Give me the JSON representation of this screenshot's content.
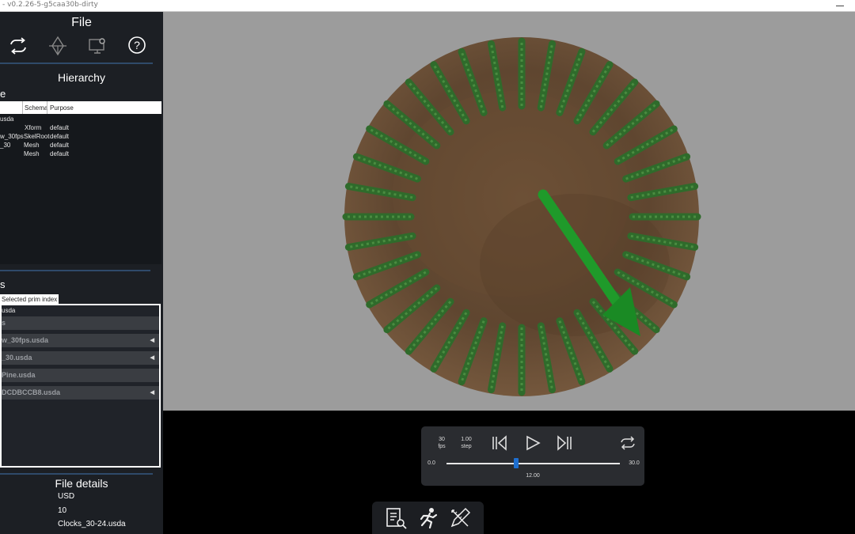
{
  "window": {
    "title": "- v0.2.26-5-g5caa30b-dirty"
  },
  "sidebar": {
    "file_title": "File",
    "toolbar": [
      {
        "name": "refresh-icon"
      },
      {
        "name": "pen-tool-icon"
      },
      {
        "name": "monitor-settings-icon"
      },
      {
        "name": "help-icon"
      }
    ],
    "hierarchy": {
      "title": "Hierarchy",
      "section_label": "e",
      "columns": {
        "schema": "Schema",
        "purpose": "Purpose"
      },
      "rows": [
        {
          "name": "usda",
          "schema": "",
          "purpose": ""
        },
        {
          "name": "",
          "schema": "Xform",
          "purpose": "default"
        },
        {
          "name": "w_30fps",
          "schema": "SkelRoot",
          "purpose": "default"
        },
        {
          "name": "_30",
          "schema": "Mesh",
          "purpose": "default"
        },
        {
          "name": "",
          "schema": "Mesh",
          "purpose": "default"
        }
      ]
    },
    "layers": {
      "section_label": "s",
      "tab_label": "Selected prim index",
      "first_line": "usda",
      "rows": [
        {
          "label": "s",
          "expandable": false
        },
        {
          "label": "w_30fps.usda",
          "expandable": true
        },
        {
          "label": "_30.usda",
          "expandable": true
        },
        {
          "label": "Pine.usda",
          "expandable": false
        },
        {
          "label": "DCDBCCB8.usda",
          "expandable": true
        }
      ]
    },
    "file_details": {
      "title": "File details",
      "values": [
        "USD",
        "10",
        "Clocks_30-24.usda"
      ]
    }
  },
  "timeline": {
    "fps_value": "30",
    "fps_label": "fps",
    "step_value": "1.00",
    "step_label": "step",
    "start": "0.0",
    "end": "30.0",
    "current": "12.00",
    "progress": 0.4
  },
  "bottom_toolbar": [
    {
      "name": "inspect-document-icon"
    },
    {
      "name": "animation-run-icon"
    },
    {
      "name": "edit-tools-icon"
    }
  ],
  "colors": {
    "accent": "#1e6fd0",
    "stick_green": "#2f6b2b",
    "arrow_green": "#1f9a2a",
    "wood": "#6b4f36",
    "viewport_bg": "#9c9c9c"
  }
}
